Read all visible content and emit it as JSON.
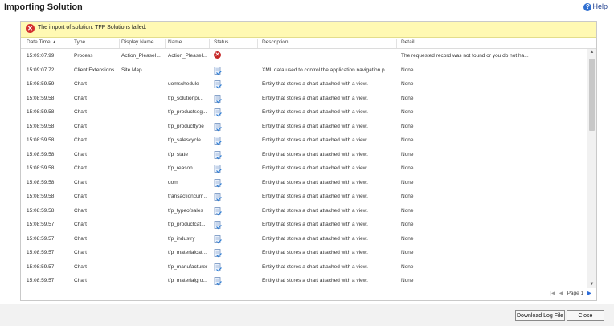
{
  "window": {
    "title": "Importing Solution",
    "help_label": "Help",
    "help_icon": "help-icon"
  },
  "banner": {
    "icon": "error-icon",
    "message": "The import of solution: TFP Solutions failed."
  },
  "table": {
    "columns": [
      {
        "label": "Date Time",
        "sorted": "ascending"
      },
      {
        "label": "Type"
      },
      {
        "label": "Display Name"
      },
      {
        "label": "Name"
      },
      {
        "label": "Status"
      },
      {
        "label": "Description"
      },
      {
        "label": "Detail"
      }
    ],
    "rows": [
      {
        "datetime": "15:09:07.99",
        "type": "Process",
        "display_name": "Action_PleaseI...",
        "name": "Action_PleaseI...",
        "status": "error",
        "description": "",
        "detail": "The requested record was not found or you do not ha..."
      },
      {
        "datetime": "15:09:07.72",
        "type": "Client Extensions",
        "display_name": "Site Map",
        "name": "",
        "status": "success",
        "description": "XML data used to control the application navigation p...",
        "detail": "None"
      },
      {
        "datetime": "15:08:59.59",
        "type": "Chart",
        "display_name": "",
        "name": "uomschedule",
        "status": "success",
        "description": "Entity that stores a chart attached with a view.",
        "detail": "None"
      },
      {
        "datetime": "15:08:59.58",
        "type": "Chart",
        "display_name": "",
        "name": "tfp_solutionpr...",
        "status": "success",
        "description": "Entity that stores a chart attached with a view.",
        "detail": "None"
      },
      {
        "datetime": "15:08:59.58",
        "type": "Chart",
        "display_name": "",
        "name": "tfp_productseg...",
        "status": "success",
        "description": "Entity that stores a chart attached with a view.",
        "detail": "None"
      },
      {
        "datetime": "15:08:59.58",
        "type": "Chart",
        "display_name": "",
        "name": "tfp_producttype",
        "status": "success",
        "description": "Entity that stores a chart attached with a view.",
        "detail": "None"
      },
      {
        "datetime": "15:08:59.58",
        "type": "Chart",
        "display_name": "",
        "name": "tfp_salescycle",
        "status": "success",
        "description": "Entity that stores a chart attached with a view.",
        "detail": "None"
      },
      {
        "datetime": "15:08:59.58",
        "type": "Chart",
        "display_name": "",
        "name": "tfp_state",
        "status": "success",
        "description": "Entity that stores a chart attached with a view.",
        "detail": "None"
      },
      {
        "datetime": "15:08:59.58",
        "type": "Chart",
        "display_name": "",
        "name": "tfp_reason",
        "status": "success",
        "description": "Entity that stores a chart attached with a view.",
        "detail": "None"
      },
      {
        "datetime": "15:08:59.58",
        "type": "Chart",
        "display_name": "",
        "name": "uom",
        "status": "success",
        "description": "Entity that stores a chart attached with a view.",
        "detail": "None"
      },
      {
        "datetime": "15:08:59.58",
        "type": "Chart",
        "display_name": "",
        "name": "transactioncurr...",
        "status": "success",
        "description": "Entity that stores a chart attached with a view.",
        "detail": "None"
      },
      {
        "datetime": "15:08:59.58",
        "type": "Chart",
        "display_name": "",
        "name": "tfp_typeofsales",
        "status": "success",
        "description": "Entity that stores a chart attached with a view.",
        "detail": "None"
      },
      {
        "datetime": "15:08:59.57",
        "type": "Chart",
        "display_name": "",
        "name": "tfp_productcat...",
        "status": "success",
        "description": "Entity that stores a chart attached with a view.",
        "detail": "None"
      },
      {
        "datetime": "15:08:59.57",
        "type": "Chart",
        "display_name": "",
        "name": "tfp_industry",
        "status": "success",
        "description": "Entity that stores a chart attached with a view.",
        "detail": "None"
      },
      {
        "datetime": "15:08:59.57",
        "type": "Chart",
        "display_name": "",
        "name": "tfp_materialcat...",
        "status": "success",
        "description": "Entity that stores a chart attached with a view.",
        "detail": "None"
      },
      {
        "datetime": "15:08:59.57",
        "type": "Chart",
        "display_name": "",
        "name": "tfp_manufacturer",
        "status": "success",
        "description": "Entity that stores a chart attached with a view.",
        "detail": "None"
      },
      {
        "datetime": "15:08:59.57",
        "type": "Chart",
        "display_name": "",
        "name": "tfp_materialgro...",
        "status": "success",
        "description": "Entity that stores a chart attached with a view.",
        "detail": "None"
      }
    ]
  },
  "pager": {
    "label": "Page 1"
  },
  "footer": {
    "download_label": "Download Log File",
    "close_label": "Close"
  },
  "colors": {
    "banner_bg": "#fff9b3",
    "error_red": "#d32f2f",
    "accent_blue": "#2a6ad8"
  }
}
